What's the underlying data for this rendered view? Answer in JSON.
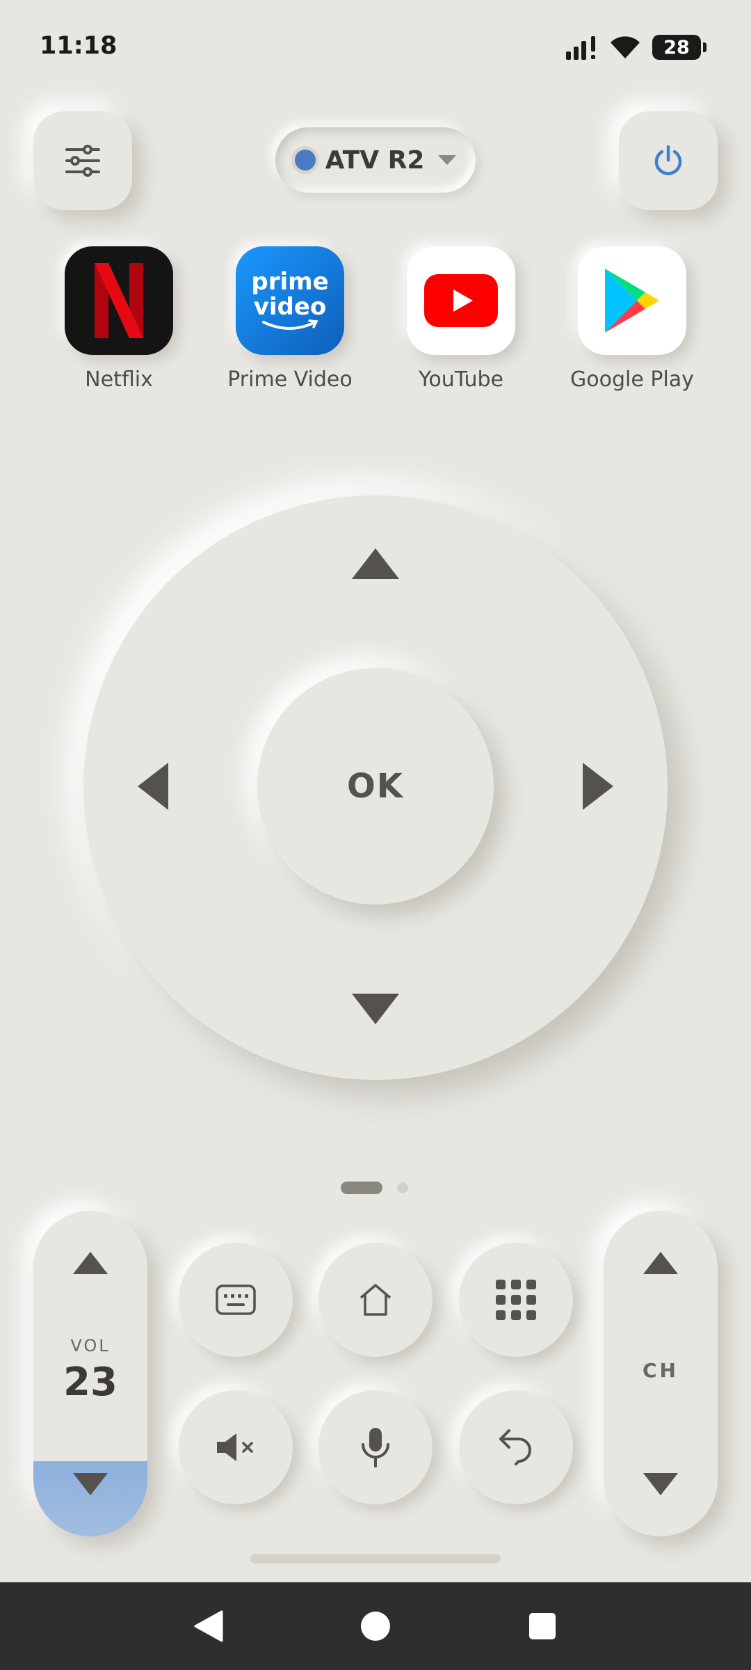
{
  "status_bar": {
    "time": "11:18",
    "battery": "28",
    "icons": [
      "signal-icon",
      "wifi-icon",
      "battery-icon"
    ]
  },
  "header": {
    "device_name": "ATV R2",
    "device_status_color": "#4a7bc4",
    "power_color": "#3f7fcf"
  },
  "apps": [
    {
      "label": "Netflix",
      "icon": "netflix-icon",
      "color": "#e50914"
    },
    {
      "label": "Prime Video",
      "icon": "prime-video-icon",
      "logo_line1": "prime",
      "logo_line2": "video",
      "color": "#1a98ff"
    },
    {
      "label": "YouTube",
      "icon": "youtube-icon",
      "color": "#ff0000"
    },
    {
      "label": "Google Play",
      "icon": "google-play-icon"
    }
  ],
  "dpad": {
    "ok_label": "OK"
  },
  "pager": {
    "pages": 2,
    "active_page": 1
  },
  "volume": {
    "label": "VOL",
    "value": "23",
    "accent_color": "#9bb8e0"
  },
  "channel": {
    "label": "CH"
  },
  "controls": [
    {
      "icon": "keyboard-icon"
    },
    {
      "icon": "home-icon"
    },
    {
      "icon": "app-grid-icon"
    },
    {
      "icon": "mute-icon"
    },
    {
      "icon": "microphone-icon"
    },
    {
      "icon": "back-icon"
    }
  ],
  "nav_bar": {
    "buttons": [
      "nav-back-icon",
      "nav-home-icon",
      "nav-recents-icon"
    ]
  }
}
